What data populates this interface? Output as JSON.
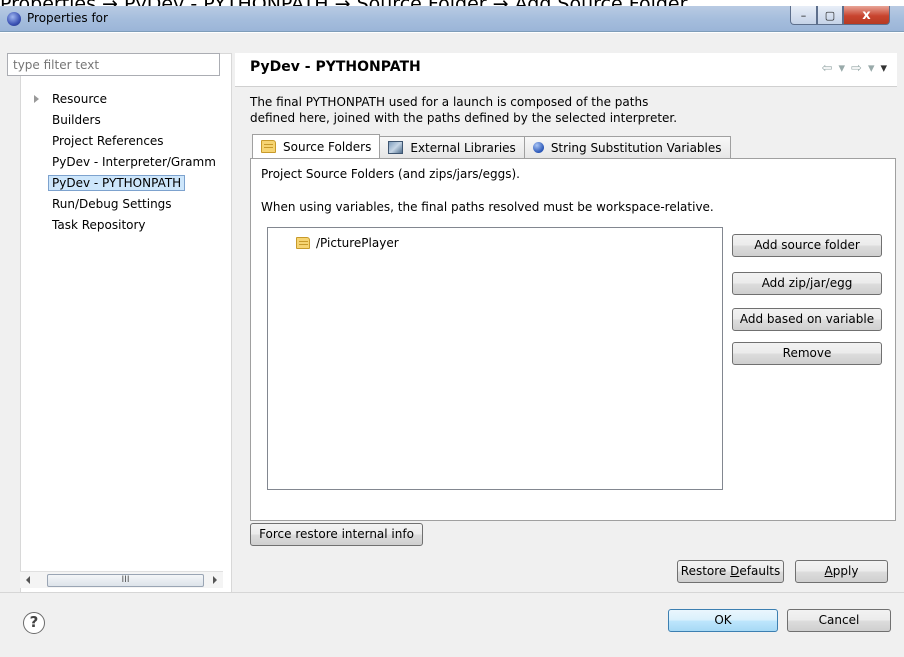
{
  "caption": "Properties → PyDev - PYTHONPATH → Source Folder → Add Source Folder",
  "window": {
    "title": "Properties for",
    "minimize": "–",
    "maximize": "▢",
    "close": "x"
  },
  "left_pane": {
    "filter_placeholder": "type filter text",
    "tree": [
      {
        "label": "Resource",
        "expandable": true
      },
      {
        "label": "Builders"
      },
      {
        "label": "Project References"
      },
      {
        "label": "PyDev - Interpreter/Gramm"
      },
      {
        "label": "PyDev - PYTHONPATH",
        "selected": true
      },
      {
        "label": "Run/Debug Settings"
      },
      {
        "label": "Task Repository"
      }
    ],
    "scroll_thumb": "III"
  },
  "header": {
    "title": "PyDev - PYTHONPATH",
    "nav": [
      "⇦",
      "▾",
      "⇨",
      "▾",
      "▾"
    ]
  },
  "description": {
    "line1": "The final PYTHONPATH used for a launch is composed of the paths",
    "line2": "defined here, joined with the paths defined by the selected interpreter."
  },
  "tabs": [
    {
      "label": "Source Folders",
      "icon": "folder-icon",
      "active": true
    },
    {
      "label": "External Libraries",
      "icon": "library-icon"
    },
    {
      "label": "String Substitution Variables",
      "icon": "variable-icon"
    }
  ],
  "panel": {
    "line1": "Project Source Folders (and zips/jars/eggs).",
    "line2": "When using variables, the final paths resolved must be workspace-relative.",
    "items": [
      "/PicturePlayer"
    ],
    "buttons": {
      "add_source_folder": "Add source folder",
      "add_zip": "Add zip/jar/egg",
      "add_variable": "Add based on variable",
      "remove": "Remove"
    }
  },
  "force_restore": "Force restore internal info",
  "restore_defaults_pre": "Restore ",
  "restore_defaults_u": "D",
  "restore_defaults_post": "efaults",
  "apply_u": "A",
  "apply_post": "pply",
  "ok": "OK",
  "cancel": "Cancel",
  "help": "?"
}
